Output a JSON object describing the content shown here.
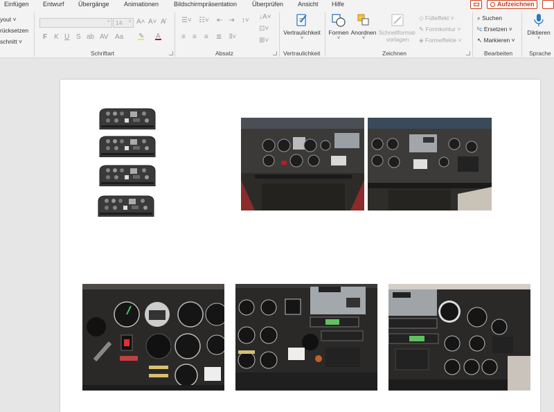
{
  "tabs": [
    "Einfügen",
    "Entwurf",
    "Übergänge",
    "Animationen",
    "Bildschirmpräsentation",
    "Überprüfen",
    "Ansicht",
    "Hilfe"
  ],
  "record_button": "Aufzeichnen",
  "ribbon": {
    "folien": {
      "layout": "yout",
      "zuruecksetzen": "rücksetzen",
      "abschnitt": "schnitt"
    },
    "schriftart": {
      "label": "Schriftart",
      "font_name": "",
      "font_size": "14",
      "bold": "F",
      "italic": "K",
      "underline": "U",
      "strike": "S",
      "shadow": "ab",
      "spacing": "AV",
      "case": "Aa"
    },
    "absatz": {
      "label": "Absatz"
    },
    "vertraulichkeit": {
      "label": "Vertraulichkeit",
      "button": "Vertraulichkeit"
    },
    "zeichnen": {
      "label": "Zeichnen",
      "formen": "Formen",
      "anordnen": "Anordnen",
      "schnellformat": "Schnellformat-",
      "vorlagen": "vorlagen",
      "fuelleffekt": "Fülleffekt",
      "formkontur": "Formkontur",
      "formeffekte": "Formeffekte"
    },
    "bearbeiten": {
      "label": "Bearbeiten",
      "suchen": "Suchen",
      "ersetzen": "Ersetzen",
      "markieren": "Markieren"
    },
    "sprache": {
      "label": "Sprache",
      "diktieren": "Diktieren"
    }
  },
  "slide": {
    "mini_panels": 4,
    "photos": [
      "cockpit-panel-photo-1",
      "cockpit-panel-photo-2",
      "cockpit-panel-photo-3",
      "cockpit-panel-photo-4",
      "cockpit-panel-photo-5"
    ]
  }
}
